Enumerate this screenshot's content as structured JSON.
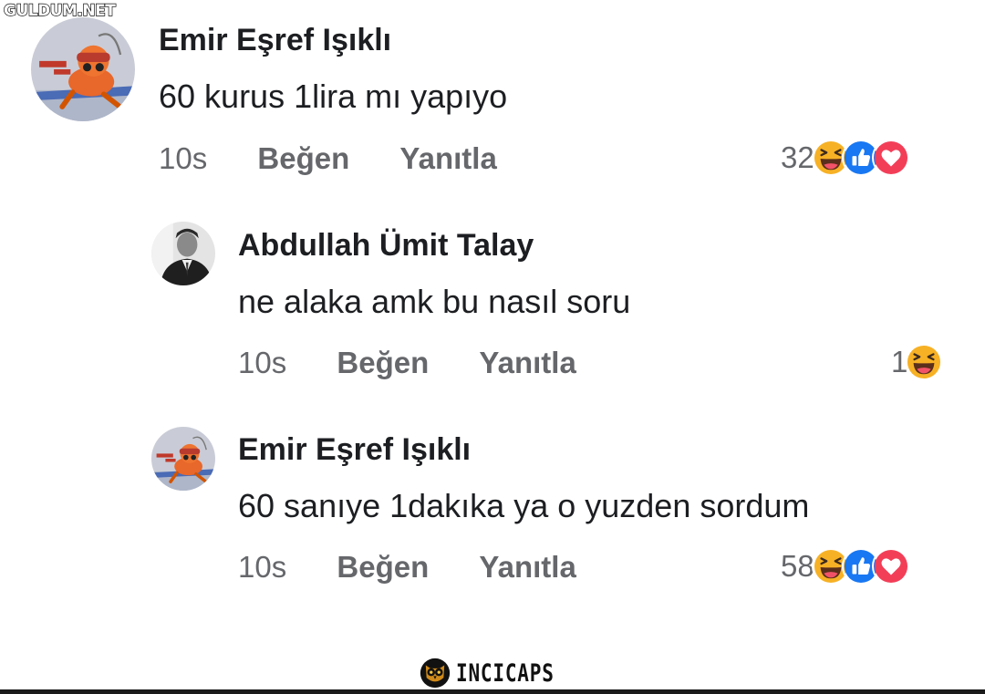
{
  "watermark_top": "GULDUM.NET",
  "watermark_bottom": "INCICAPS",
  "icons": {
    "haha": "laughing-face-icon",
    "like": "thumbs-up-icon",
    "love": "heart-icon"
  },
  "colors": {
    "name": "#1c1e21",
    "meta": "#65676b",
    "like_blue": "#1877f2",
    "love_red": "#f33e58",
    "haha_yellow": "#f7b125"
  },
  "comments": [
    {
      "author": "Emir Eşref Işıklı",
      "text": "60 kurus 1lira mı yapıyo",
      "time": "10s",
      "like_label": "Beğen",
      "reply_label": "Yanıtla",
      "reaction_count": "32",
      "reactions": [
        "haha",
        "like",
        "love"
      ]
    },
    {
      "author": "Abdullah Ümit Talay",
      "text": "ne alaka amk bu nasıl soru",
      "time": "10s",
      "like_label": "Beğen",
      "reply_label": "Yanıtla",
      "reaction_count": "1",
      "reactions": [
        "haha"
      ]
    },
    {
      "author": "Emir Eşref Işıklı",
      "text": "60 sanıye 1dakıka ya o yuzden sordum",
      "time": "10s",
      "like_label": "Beğen",
      "reply_label": "Yanıtla",
      "reaction_count": "58",
      "reactions": [
        "haha",
        "like",
        "love"
      ]
    }
  ]
}
